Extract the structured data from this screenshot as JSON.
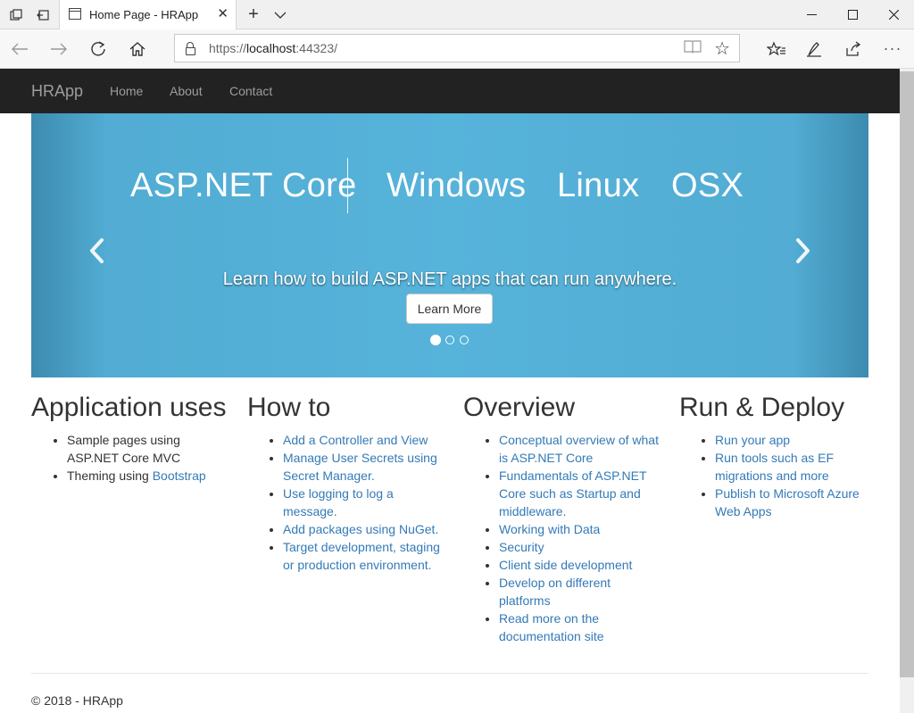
{
  "browser": {
    "tab_title": "Home Page - HRApp",
    "url_scheme": "https://",
    "url_host": "localhost",
    "url_port_path": ":44323/"
  },
  "site": {
    "brand": "HRApp",
    "nav": [
      "Home",
      "About",
      "Contact"
    ]
  },
  "carousel": {
    "banner": [
      "ASP.NET Core",
      "Windows",
      "Linux",
      "OSX"
    ],
    "caption": "Learn how to build ASP.NET apps that can run anywhere.",
    "button_label": "Learn More",
    "slide_count": 3,
    "active_slide": 1
  },
  "columns": [
    {
      "heading": "Application uses",
      "items": [
        {
          "text": "Sample pages using ASP.NET Core MVC"
        },
        {
          "text": "Theming using ",
          "link": "Bootstrap"
        }
      ]
    },
    {
      "heading": "How to",
      "items": [
        {
          "link": "Add a Controller and View"
        },
        {
          "link": "Manage User Secrets using Secret Manager."
        },
        {
          "link": "Use logging to log a message."
        },
        {
          "link": "Add packages using NuGet."
        },
        {
          "link": "Target development, staging or production environment."
        }
      ]
    },
    {
      "heading": "Overview",
      "items": [
        {
          "link": "Conceptual overview of what is ASP.NET Core"
        },
        {
          "link": "Fundamentals of ASP.NET Core such as Startup and middleware."
        },
        {
          "link": "Working with Data"
        },
        {
          "link": "Security"
        },
        {
          "link": "Client side development"
        },
        {
          "link": "Develop on different platforms"
        },
        {
          "link": "Read more on the documentation site"
        }
      ]
    },
    {
      "heading": "Run & Deploy",
      "items": [
        {
          "link": "Run your app"
        },
        {
          "link": "Run tools such as EF migrations and more"
        },
        {
          "link": "Publish to Microsoft Azure Web Apps"
        }
      ]
    }
  ],
  "footer": "© 2018 - HRApp",
  "colors": {
    "navbar_bg": "#222222",
    "carousel_bg": "#56b3da",
    "link": "#337ab7"
  }
}
